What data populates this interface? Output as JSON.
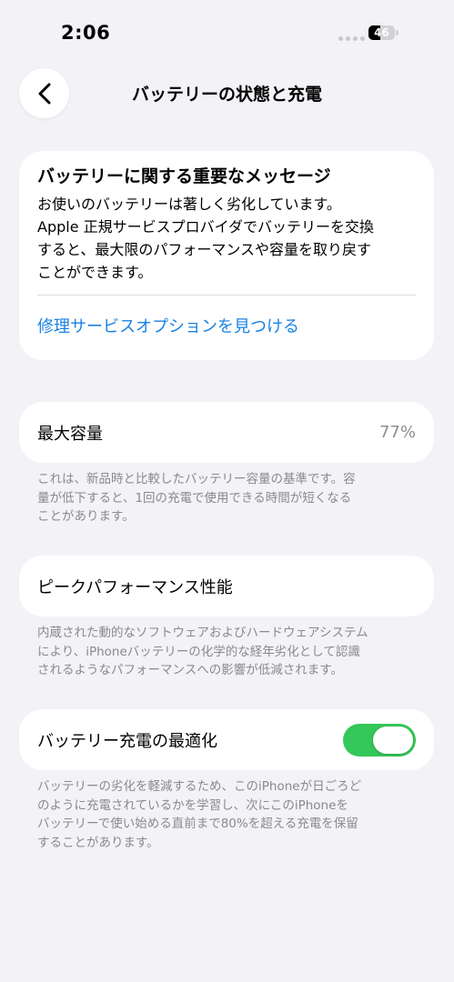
{
  "status_bar": {
    "time": "2:06",
    "battery_level": "46",
    "battery_fraction": 0.46
  },
  "nav": {
    "back_icon": "chevron-left-icon",
    "title": "バッテリーの状態と充電"
  },
  "message_card": {
    "title": "バッテリーに関する重要なメッセージ",
    "body": "お使いのバッテリーは著しく劣化しています。\nApple 正規サービスプロバイダでバッテリーを交換\nすると、最大限のパフォーマンスや容量を取り戻す\nことができます。",
    "link": "修理サービスオプションを見つける",
    "link_color": "#1a82e2"
  },
  "maximum_capacity": {
    "label": "最大容量",
    "value": "77%",
    "footnote": "これは、新品時と比較したバッテリー容量の基準です。容\n量が低下すると、1回の充電で使用できる時間が短くなる\nことがあります。"
  },
  "peak_performance": {
    "label": "ピークパフォーマンス性能",
    "footnote": "内蔵された動的なソフトウェアおよびハードウェアシステム\nにより、iPhoneバッテリーの化学的な経年劣化として認識\nされるようなパフォーマンスへの影響が低減されます。"
  },
  "optimized_charging": {
    "label": "バッテリー充電の最適化",
    "enabled": true,
    "toggle_color": "#34c759",
    "footnote": "バッテリーの劣化を軽減するため、このiPhoneが日ごろど\nのように充電されているかを学習し、次にこのiPhoneを\nバッテリーで使い始める直前まで80%を超える充電を保留\nすることがあります。"
  }
}
